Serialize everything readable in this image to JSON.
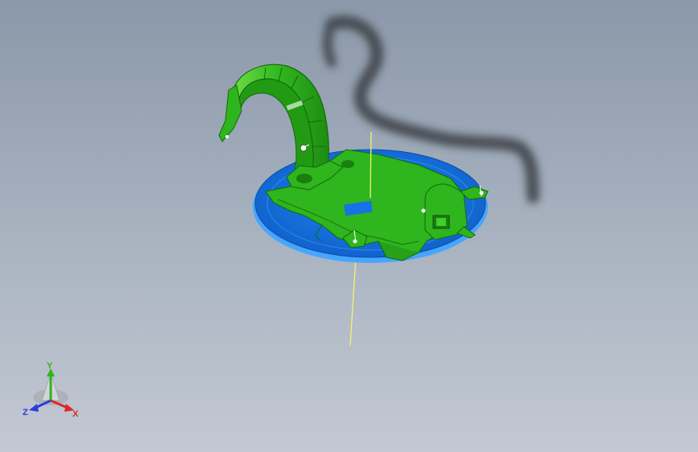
{
  "viewport": {
    "background_top": "#8b98a9",
    "background_bottom": "#c3c9d3"
  },
  "model": {
    "part_color": "#2fb51d",
    "part_dark": "#1c7d10",
    "plate_color": "#1673e6",
    "plate_rim": "#46a6ff",
    "axis_line_color": "#f4f46a",
    "shadow_color": "#3a3f45"
  },
  "triad": {
    "x_label": "X",
    "y_label": "Y",
    "z_label": "Z",
    "x_color": "#e0262a",
    "y_color": "#2fb51d",
    "z_color": "#2a3fd8"
  }
}
